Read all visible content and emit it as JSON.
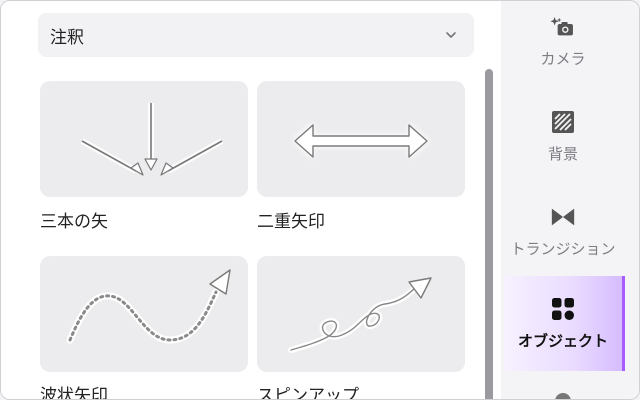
{
  "panel": {
    "dropdown": {
      "label": "注釈"
    },
    "cards": [
      {
        "label": "三本の矢"
      },
      {
        "label": "二重矢印"
      },
      {
        "label": "波状矢印"
      },
      {
        "label": "スピンアップ"
      }
    ]
  },
  "sidebar": {
    "items": [
      {
        "label": "カメラ",
        "icon": "camera-sparkle-icon"
      },
      {
        "label": "背景",
        "icon": "background-icon"
      },
      {
        "label": "トランジション",
        "icon": "transition-icon"
      },
      {
        "label": "オブジェクト",
        "icon": "objects-icon",
        "active": true
      }
    ]
  },
  "colors": {
    "accent": "#a85cff",
    "card_bg": "#ececee",
    "sidebar_bg": "#f4f4f6"
  }
}
